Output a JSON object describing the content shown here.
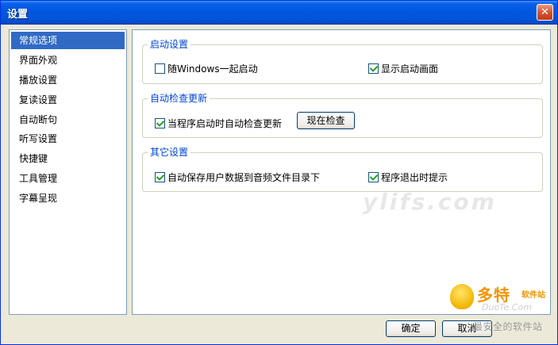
{
  "window": {
    "title": "设置"
  },
  "sidebar": {
    "items": [
      {
        "label": "常规选项",
        "selected": true
      },
      {
        "label": "界面外观"
      },
      {
        "label": "播放设置"
      },
      {
        "label": "复读设置"
      },
      {
        "label": "自动断句"
      },
      {
        "label": "听写设置"
      },
      {
        "label": "快捷键"
      },
      {
        "label": "工具管理"
      },
      {
        "label": "字幕呈现"
      }
    ]
  },
  "groups": {
    "startup": {
      "title": "启动设置",
      "options": [
        {
          "label": "随Windows一起启动",
          "checked": false
        },
        {
          "label": "显示启动画面",
          "checked": true
        }
      ]
    },
    "update": {
      "title": "自动检查更新",
      "options": [
        {
          "label": "当程序启动时自动检查更新",
          "checked": true
        }
      ],
      "check_now_label": "现在检查"
    },
    "other": {
      "title": "其它设置",
      "options": [
        {
          "label": "自动保存用户数据到音频文件目录下",
          "checked": true
        },
        {
          "label": "程序退出时提示",
          "checked": true
        }
      ]
    }
  },
  "buttons": {
    "ok_label": "确定",
    "cancel_label": "取消"
  },
  "watermarks": {
    "center": "ylifs.com",
    "brand": "多特",
    "brand_sub": "软件站",
    "brand_url": "DuoTe.Com",
    "footer": "最安全的软件站"
  },
  "colors": {
    "titlebar": "#0058e0",
    "selection": "#316ac5",
    "group_title": "#0046d5",
    "check_mark": "#21a121"
  }
}
